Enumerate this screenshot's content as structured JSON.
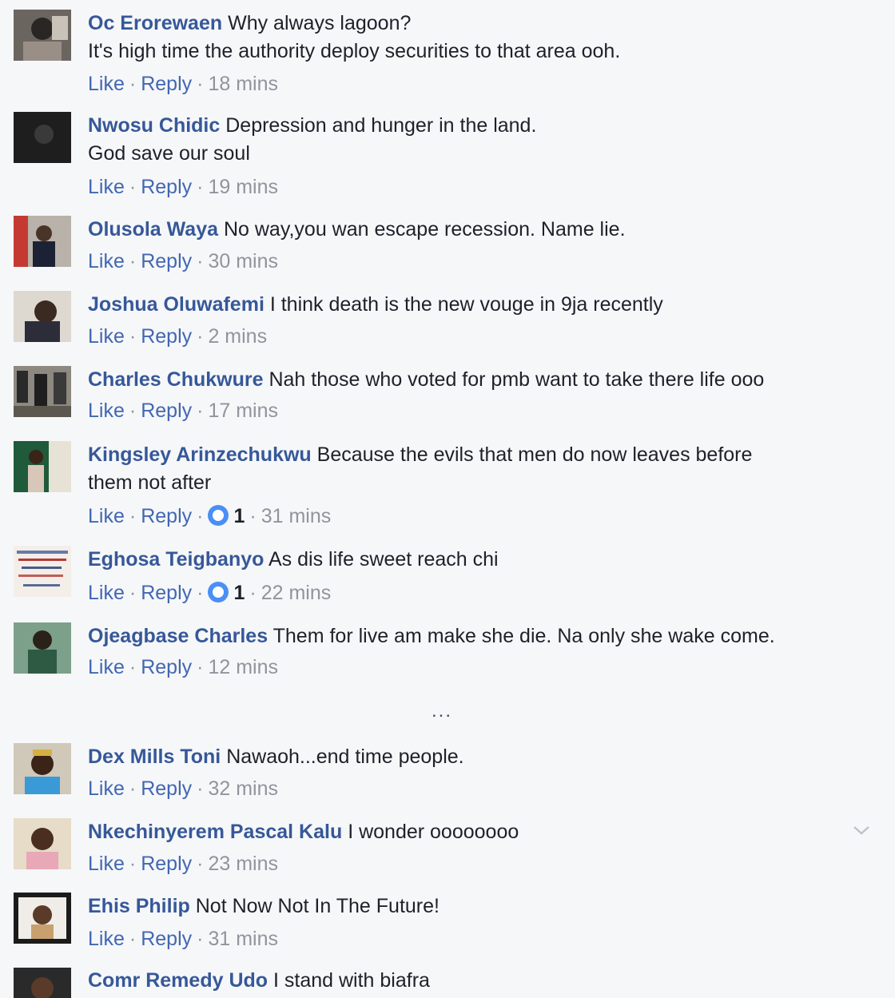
{
  "comments": [
    {
      "name": "Oc Erorewaen",
      "text": "Why always lagoon?",
      "text2": "It's high time the authority deploy securities to that area ooh.",
      "like": "Like",
      "reply": "Reply",
      "time": "18 mins",
      "reactions": ""
    },
    {
      "name": "Nwosu Chidic",
      "text": "Depression and hunger in the land.",
      "text2": "God save our soul",
      "like": "Like",
      "reply": "Reply",
      "time": "19 mins",
      "reactions": ""
    },
    {
      "name": "Olusola Waya",
      "text": "No way,you wan escape recession. Name lie.",
      "text2": "",
      "like": "Like",
      "reply": "Reply",
      "time": "30 mins",
      "reactions": ""
    },
    {
      "name": "Joshua Oluwafemi",
      "text": "I think death is the new vouge in 9ja recently",
      "text2": "",
      "like": "Like",
      "reply": "Reply",
      "time": "2 mins",
      "reactions": ""
    },
    {
      "name": "Charles Chukwure",
      "text": "Nah those who voted for pmb want to take there life ooo",
      "text2": "",
      "like": "Like",
      "reply": "Reply",
      "time": "17 mins",
      "reactions": ""
    },
    {
      "name": "Kingsley Arinzechukwu",
      "text": "Because the evils that men do now leaves before",
      "text2": "them not after",
      "like": "Like",
      "reply": "Reply",
      "time": "31 mins",
      "reactions": "1"
    },
    {
      "name": "Eghosa Teigbanyo",
      "text": "As dis life sweet reach chi",
      "text2": "",
      "like": "Like",
      "reply": "Reply",
      "time": "22 mins",
      "reactions": "1"
    },
    {
      "name": "Ojeagbase Charles",
      "text": "Them for live am make she die. Na only she wake come.",
      "text2": "",
      "like": "Like",
      "reply": "Reply",
      "time": "12 mins",
      "reactions": ""
    },
    {
      "name": "Dex Mills Toni",
      "text": "Nawaoh...end time people.",
      "text2": "",
      "like": "Like",
      "reply": "Reply",
      "time": "32 mins",
      "reactions": ""
    },
    {
      "name": "Nkechinyerem Pascal Kalu",
      "text": "I wonder oooooooo",
      "text2": "",
      "like": "Like",
      "reply": "Reply",
      "time": "23 mins",
      "reactions": ""
    },
    {
      "name": "Ehis Philip",
      "text": "Not Now Not In The Future!",
      "text2": "",
      "like": "Like",
      "reply": "Reply",
      "time": "31 mins",
      "reactions": ""
    },
    {
      "name": "Comr Remedy Udo",
      "text": "I stand with biafra",
      "text2": "",
      "like": "",
      "reply": "",
      "time": "",
      "reactions": ""
    }
  ],
  "separator": "...",
  "icons": {
    "reaction": "like-reaction-icon",
    "menu": "chevron-down-icon"
  },
  "colors": {
    "name": "#365899",
    "link": "#4267b2",
    "meta": "#90949c",
    "reaction": "#4a8ff5"
  }
}
